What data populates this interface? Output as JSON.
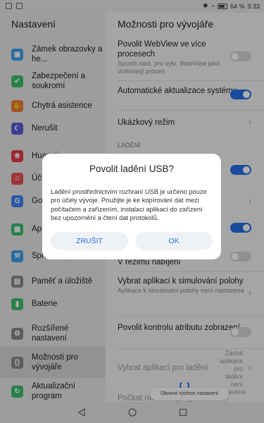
{
  "status_bar": {
    "battery": "64 %",
    "time": "9:33"
  },
  "left_pane": {
    "title": "Nastavení",
    "items": [
      {
        "label": "Zámek obrazovky a he...",
        "icon": "lock-icon",
        "color": "#3aa0f0"
      },
      {
        "label": "Zabezpečení a soukromí",
        "icon": "shield-icon",
        "color": "#3bbf6a"
      },
      {
        "label": "Chytrá asistence",
        "icon": "hand-icon",
        "color": "#f07a3a"
      },
      {
        "label": "Nerušit",
        "icon": "moon-icon",
        "color": "#5b5bd6"
      },
      {
        "label": "Huawei",
        "icon": "huawei-icon",
        "color": "#e63946"
      },
      {
        "label": "Účty",
        "icon": "account-icon",
        "color": "#e65252"
      },
      {
        "label": "Google",
        "icon": "google-icon",
        "color": "#4285f4"
      },
      {
        "label": "Aplikace",
        "icon": "apps-icon",
        "color": "#3bbf6a"
      },
      {
        "label": "Správce oprávnění",
        "icon": "key-icon",
        "color": "#3aa0f0"
      },
      {
        "label": "Paměť a úložiště",
        "icon": "storage-icon",
        "color": "#8a8a8a"
      },
      {
        "label": "Baterie",
        "icon": "battery-icon",
        "color": "#3bbf6a"
      },
      {
        "label": "Rozšířené nastavení",
        "icon": "gear-icon",
        "color": "#8a8a8a"
      },
      {
        "label": "Možnosti pro vývojáře",
        "icon": "braces-icon",
        "color": "#8a8a8a"
      },
      {
        "label": "Aktualizační program",
        "icon": "update-icon",
        "color": "#3bbf6a"
      }
    ]
  },
  "right_pane": {
    "title": "Možnosti pro vývojáře",
    "items": [
      {
        "title": "Povolit WebView ve více procesech",
        "subtitle": "Spustit nást. pro vykr. WebView jako izolovaný proces"
      },
      {
        "title": "Automatické aktualizace systému"
      },
      {
        "title": "Ukázkový režim"
      },
      {
        "title": "V režimu nabíjení"
      },
      {
        "title": "Vybrat aplikaci k simulování polohy",
        "subtitle": "Aplikace k simulování polohy není nastavena"
      },
      {
        "title": "Povolit kontrolu atributu zobrazení"
      },
      {
        "title": "Vybrat aplikaci pro ladění",
        "value": "Žádná aplikace pro ladění není nastavena"
      },
      {
        "title": "Počkat na ladicí program"
      }
    ],
    "section_label": "LADĚNÍ"
  },
  "dialog": {
    "title": "Povolit ladění USB?",
    "message": "Ladění prostřednictvím rozhraní USB je určeno pouze pro účely vývoje. Použijte je ke kopírování dat mezi počítačem a zařízením, instalaci aplikací do zařízení bez upozornění a čtení dat protokolů.",
    "cancel": "ZRUŠIT",
    "ok": "OK"
  },
  "toast": {
    "text": "Obnovit výchozí nastavení"
  },
  "colors": {
    "accent": "#256fe6"
  }
}
